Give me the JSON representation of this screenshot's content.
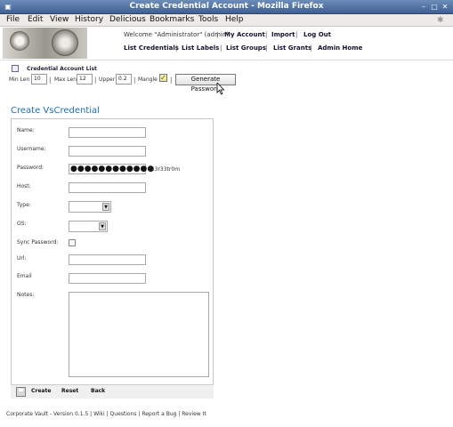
{
  "window": {
    "title": "Create Credential Account - Mozilla Firefox"
  },
  "menubar": {
    "items": [
      {
        "label": "File"
      },
      {
        "label": "Edit"
      },
      {
        "label": "View"
      },
      {
        "label": "History"
      },
      {
        "label": "Delicious"
      },
      {
        "label": "Bookmarks"
      },
      {
        "label": "Tools"
      },
      {
        "label": "Help"
      }
    ]
  },
  "header": {
    "welcome": "Welcome \"Administrator\" (admin)",
    "links": [
      "My Account",
      "Import",
      "Log Out"
    ],
    "nav": [
      "List Credentials",
      "List Labels",
      "List Groups",
      "List Grants",
      "Admin Home"
    ],
    "separator": "|"
  },
  "generator": {
    "title": "Credential Account List",
    "min_label": "Min Len",
    "min_value": "10",
    "max_label": "Max Len",
    "max_value": "12",
    "upper_label": "Upper",
    "upper_value": "0.2",
    "mangle_label": "Mangle",
    "mangle_checked": true,
    "button": "Generate Password"
  },
  "form": {
    "title": "Create VsCredential",
    "name_label": "Name:",
    "username_label": "Username:",
    "password_label": "Password:",
    "password_mask": "●●●●●●●●●●●●",
    "password_plain": "313r33tr0m",
    "host_label": "Host:",
    "type_label": "Type:",
    "os_label": "OS:",
    "sync_label": "Sync Password:",
    "url_label": "Url:",
    "email_label": "Email",
    "notes_label": "Notes:"
  },
  "actions": {
    "create": "Create",
    "reset": "Reset",
    "back": "Back"
  },
  "footer": "Corporate Vault - Version 0.1.5 | Wiki | Questions | Report a Bug | Review It"
}
